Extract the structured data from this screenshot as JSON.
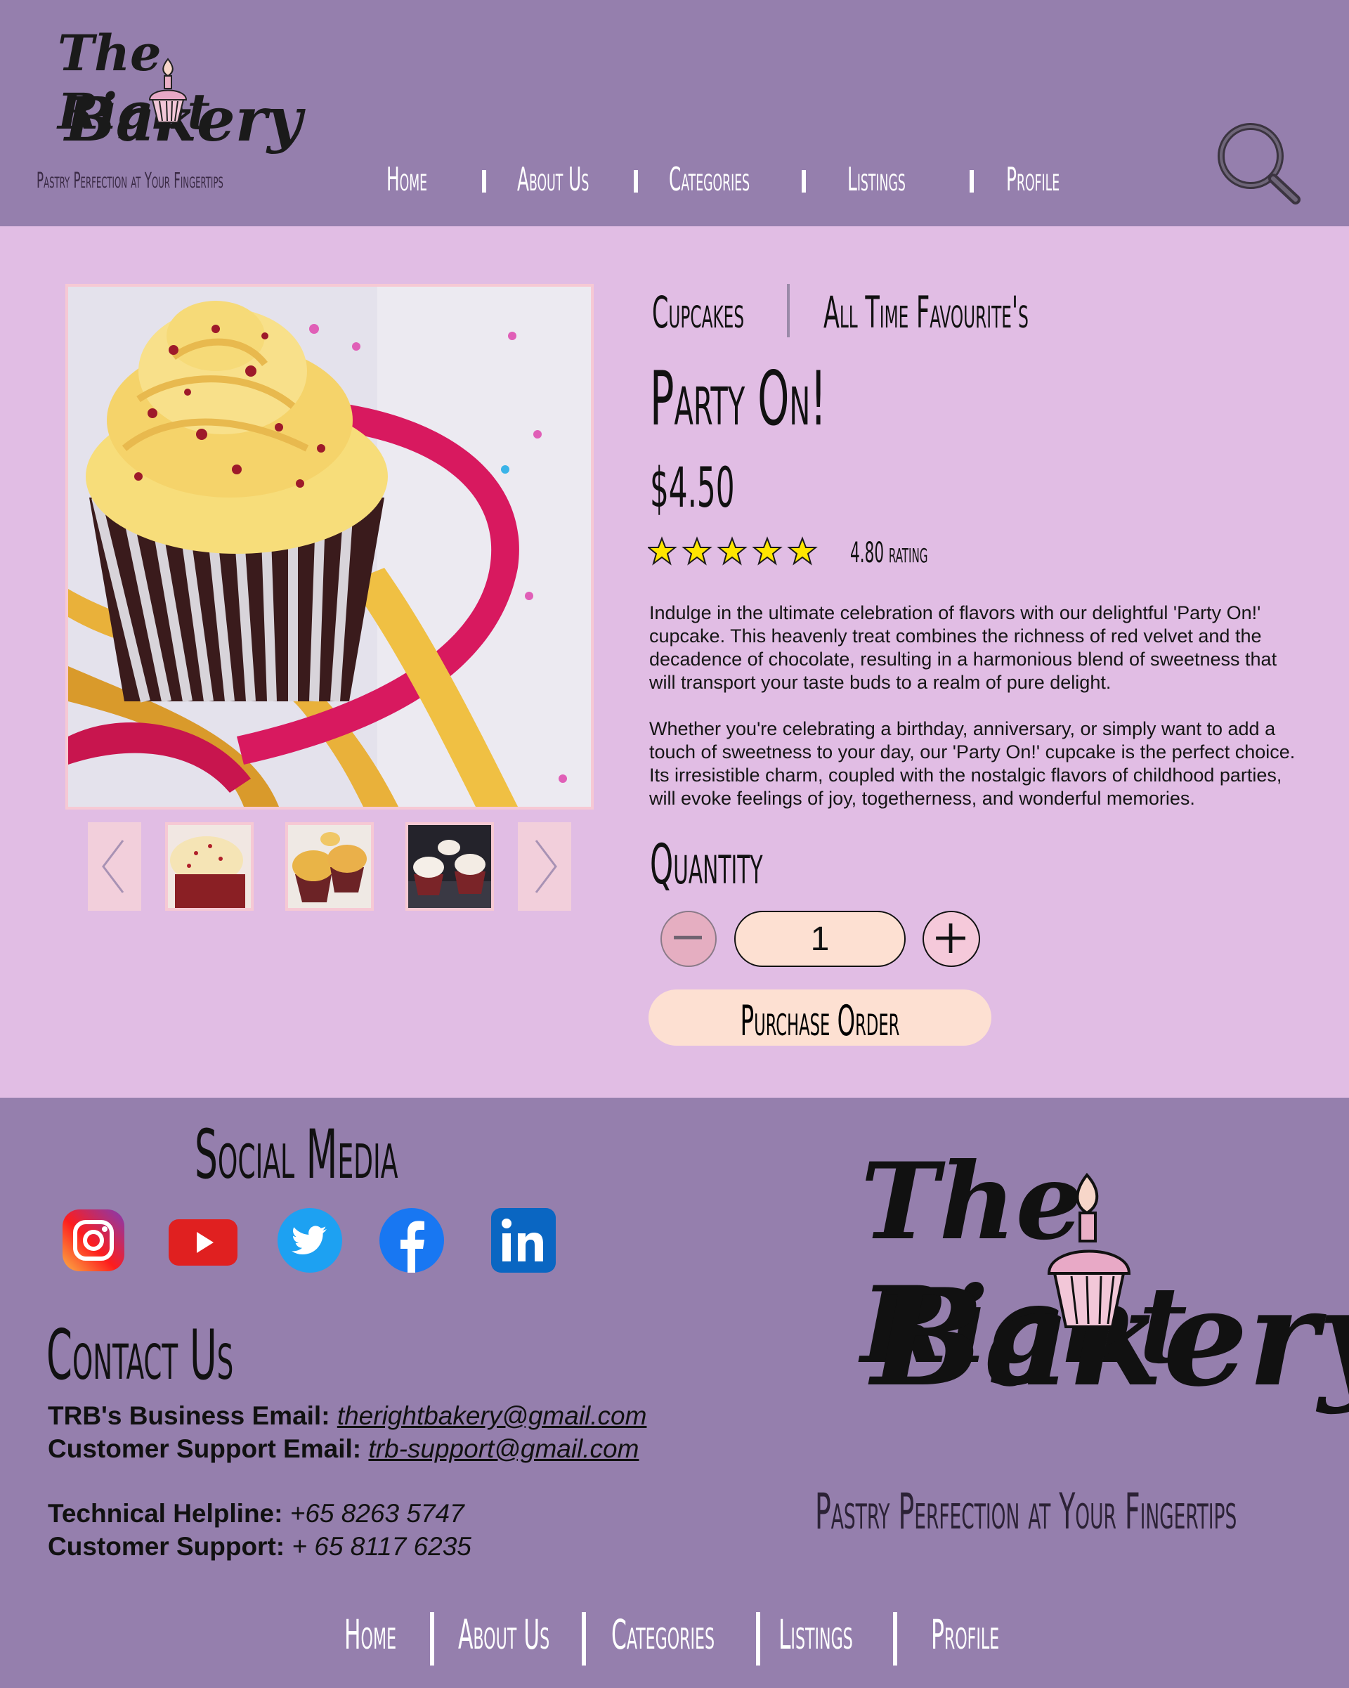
{
  "brand": {
    "line1": "The Right",
    "line2": "Bakery",
    "tagline": "Pastry Perfection at Your Fingertips"
  },
  "nav": {
    "items": [
      "Home",
      "About Us",
      "Categories",
      "Listings",
      "Profile"
    ]
  },
  "product": {
    "category": "Cupcakes",
    "subcategory": "All Time Favourite's",
    "title": "Party On!",
    "price": "$4.50",
    "stars": 5,
    "rating_text": "4.80 rating",
    "description": [
      "Indulge in the ultimate celebration of flavors with our delightful 'Party On!' cupcake. This heavenly treat combines the richness of red velvet and the decadence of chocolate, resulting in a harmonious blend of sweetness that will transport your taste buds to a realm of pure delight.",
      "Whether you're celebrating a birthday, anniversary, or simply want to add a touch of sweetness to your day, our 'Party On!' cupcake is the perfect choice. Its irresistible charm, coupled with the nostalgic flavors of childhood parties, will evoke feelings of joy, togetherness, and wonderful memories."
    ],
    "quantity_label": "Quantity",
    "quantity_value": "1",
    "purchase_label": "Purchase Order"
  },
  "footer": {
    "social_title": "Social Media",
    "social_icons": [
      "instagram-icon",
      "youtube-icon",
      "twitter-icon",
      "facebook-icon",
      "linkedin-icon"
    ],
    "contact_title": "Contact Us",
    "business_email_label": "TRB's Business Email:",
    "business_email": "therightbakery@gmail.com",
    "support_email_label": "Customer Support Email:",
    "support_email": "trb-support@gmail.com",
    "helpline_label": "Technical Helpline:",
    "helpline": "+65 8263 5747",
    "support_phone_label": "Customer Support:",
    "support_phone": "+ 65 8117 6235"
  },
  "colors": {
    "header_bg": "#957fad",
    "page_bg": "#e1bde4",
    "button_bg": "#fde0d2",
    "star": "#ffe600"
  }
}
